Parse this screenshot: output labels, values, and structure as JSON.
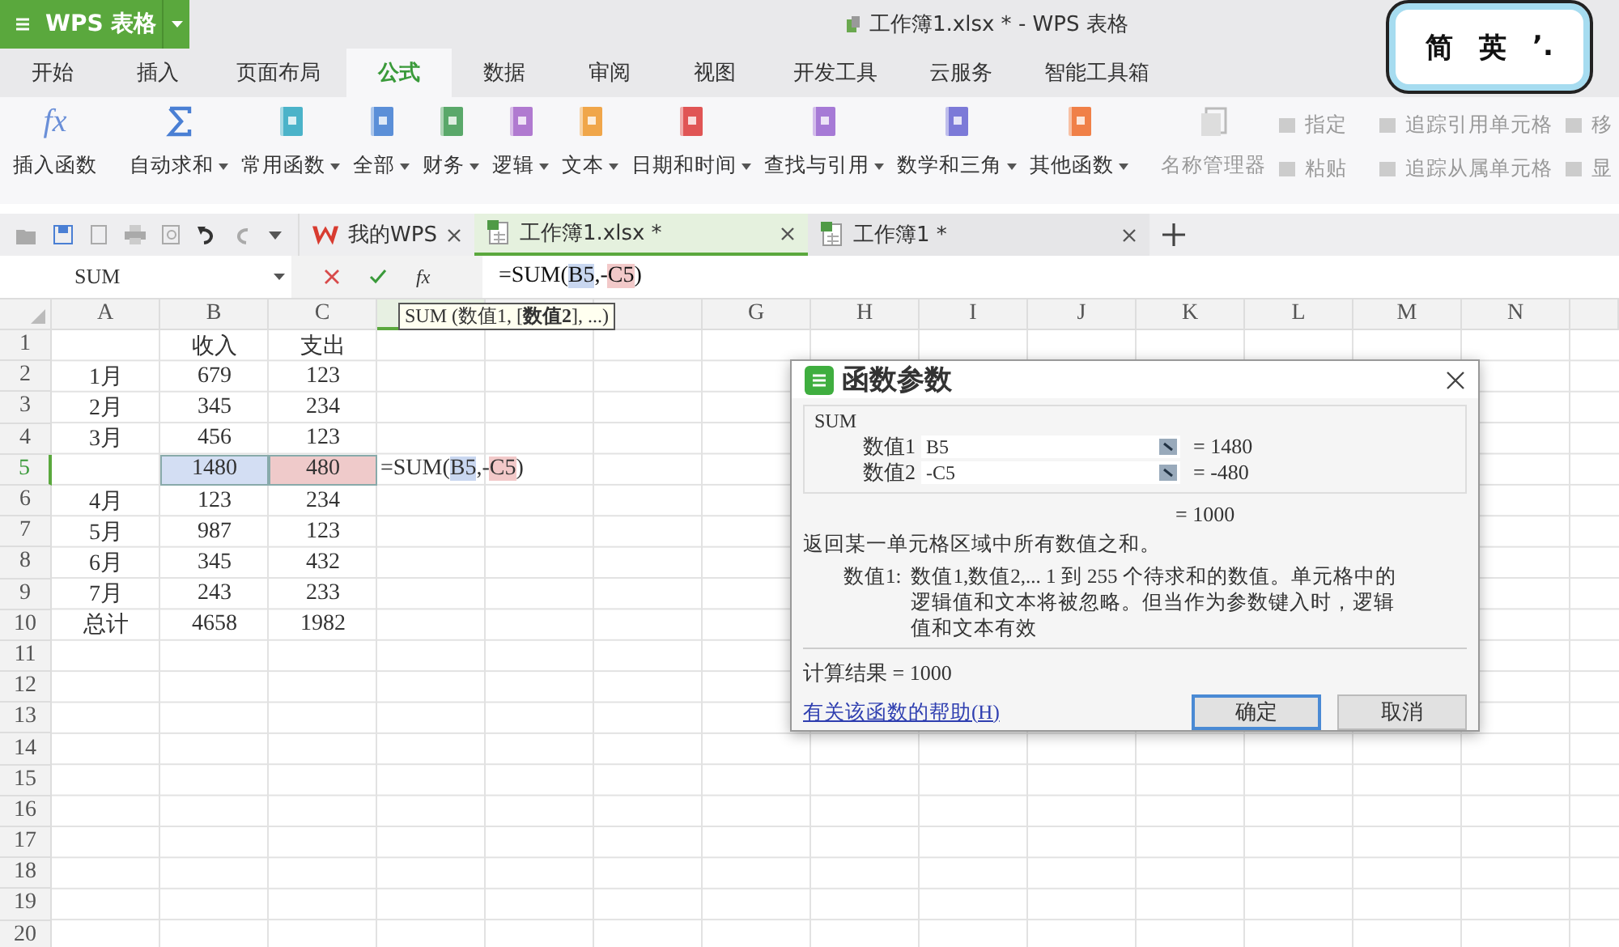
{
  "app_button": {
    "label": "WPS 表格"
  },
  "window": {
    "title": "工作簿1.xlsx * - WPS 表格"
  },
  "ime": {
    "chars": [
      "简",
      "英",
      "’."
    ]
  },
  "menu_tabs": [
    {
      "label": "开始",
      "selected": false
    },
    {
      "label": "插入",
      "selected": false
    },
    {
      "label": "页面布局",
      "selected": false
    },
    {
      "label": "公式",
      "selected": true
    },
    {
      "label": "数据",
      "selected": false
    },
    {
      "label": "审阅",
      "selected": false
    },
    {
      "label": "视图",
      "selected": false
    },
    {
      "label": "开发工具",
      "selected": false
    },
    {
      "label": "云服务",
      "selected": false
    },
    {
      "label": "智能工具箱",
      "selected": false
    }
  ],
  "ribbon": {
    "insert_function": {
      "icon": "fx",
      "label": "插入函数"
    },
    "functions": [
      {
        "label": "自动求和",
        "kind": "sigma",
        "color": "#4a7fd4"
      },
      {
        "label": "常用函数",
        "kind": "book",
        "color": "#4bb3c9"
      },
      {
        "label": "全部",
        "kind": "book",
        "color": "#5b8fd8"
      },
      {
        "label": "财务",
        "kind": "book",
        "color": "#5aa86a"
      },
      {
        "label": "逻辑",
        "kind": "book",
        "color": "#b07ad0"
      },
      {
        "label": "文本",
        "kind": "book",
        "color": "#f0a64a"
      },
      {
        "label": "日期和时间",
        "kind": "book",
        "color": "#e05555"
      },
      {
        "label": "查找与引用",
        "kind": "book",
        "color": "#a67ad6"
      },
      {
        "label": "数学和三角",
        "kind": "book",
        "color": "#7c7ad8"
      },
      {
        "label": "其他函数",
        "kind": "book",
        "color": "#f08048"
      }
    ],
    "name_manager": {
      "label": "名称管理器",
      "disabled": true
    },
    "small_buttons": [
      {
        "label": "指定",
        "disabled": true
      },
      {
        "label": "粘贴",
        "disabled": true
      }
    ],
    "trace_buttons": [
      {
        "label": "追踪引用单元格",
        "disabled": true
      },
      {
        "label": "追踪从属单元格",
        "disabled": true
      }
    ],
    "cut_buttons": [
      {
        "label": "移",
        "disabled": true
      },
      {
        "label": "显",
        "disabled": true
      }
    ]
  },
  "doc_tabs": [
    {
      "label": "我的WPS",
      "kind": "home",
      "selected": false
    },
    {
      "label": "工作簿1.xlsx *",
      "kind": "sheet",
      "selected": true
    },
    {
      "label": "工作簿1 *",
      "kind": "sheet",
      "selected": false
    }
  ],
  "formula_bar": {
    "name_box": "SUM",
    "fx_button": "fx",
    "segments": [
      {
        "text": "=SUM("
      },
      {
        "text": "B5",
        "color": "#c9d7f0"
      },
      {
        "text": ",-"
      },
      {
        "text": "C5",
        "color": "#f2c9c9"
      },
      {
        "text": ")"
      }
    ]
  },
  "sheet": {
    "columns": [
      {
        "label": "A",
        "selected": false
      },
      {
        "label": "B",
        "selected": false
      },
      {
        "label": "C",
        "selected": false
      },
      {
        "selected": true
      },
      {
        "selected": false
      },
      {
        "selected": false
      },
      {
        "label": "G",
        "selected": false
      },
      {
        "label": "H",
        "selected": false
      },
      {
        "label": "I",
        "selected": false
      },
      {
        "label": "J",
        "selected": false
      },
      {
        "label": "K",
        "selected": false
      },
      {
        "label": "L",
        "selected": false
      },
      {
        "label": "M",
        "selected": false
      },
      {
        "label": "N",
        "selected": false
      }
    ],
    "rows": [
      {
        "label": "1",
        "selected": false,
        "cells": [
          null,
          {
            "text": "收入"
          },
          {
            "text": "支出"
          }
        ]
      },
      {
        "label": "2",
        "selected": false,
        "cells": [
          {
            "text": "1月"
          },
          {
            "text": "679"
          },
          {
            "text": "123"
          }
        ]
      },
      {
        "label": "3",
        "selected": false,
        "cells": [
          {
            "text": "2月"
          },
          {
            "text": "345"
          },
          {
            "text": "234"
          }
        ]
      },
      {
        "label": "4",
        "selected": false,
        "cells": [
          {
            "text": "3月"
          },
          {
            "text": "456"
          },
          {
            "text": "123"
          }
        ]
      },
      {
        "label": "5",
        "selected": true,
        "cells": [
          null,
          {
            "text": "1480",
            "color": "#d3def3"
          },
          {
            "text": "480",
            "color": "#efcaca"
          },
          {
            "kind": "formula",
            "segments": [
              {
                "text": "=SUM("
              },
              {
                "text": "B5",
                "color": "#c9d7f0"
              },
              {
                "text": ",-"
              },
              {
                "text": "C5",
                "color": "#f2c9c9"
              },
              {
                "text": ")"
              }
            ]
          }
        ]
      },
      {
        "label": "6",
        "selected": false,
        "cells": [
          {
            "text": "4月"
          },
          {
            "text": "123"
          },
          {
            "text": "234"
          }
        ]
      },
      {
        "label": "7",
        "selected": false,
        "cells": [
          {
            "text": "5月"
          },
          {
            "text": "987"
          },
          {
            "text": "123"
          }
        ]
      },
      {
        "label": "8",
        "selected": false,
        "cells": [
          {
            "text": "6月"
          },
          {
            "text": "345"
          },
          {
            "text": "432"
          }
        ]
      },
      {
        "label": "9",
        "selected": false,
        "cells": [
          {
            "text": "7月"
          },
          {
            "text": "243"
          },
          {
            "text": "233"
          }
        ]
      },
      {
        "label": "10",
        "selected": false,
        "cells": [
          {
            "text": "总计"
          },
          {
            "text": "4658"
          },
          {
            "text": "1982"
          }
        ]
      },
      {
        "label": "11",
        "selected": false,
        "cells": []
      },
      {
        "label": "12",
        "selected": false,
        "cells": []
      },
      {
        "label": "13",
        "selected": false,
        "cells": []
      },
      {
        "label": "14",
        "selected": false,
        "cells": []
      },
      {
        "label": "15",
        "selected": false,
        "cells": []
      },
      {
        "label": "16",
        "selected": false,
        "cells": []
      },
      {
        "label": "17",
        "selected": false,
        "cells": []
      },
      {
        "label": "18",
        "selected": false,
        "cells": []
      },
      {
        "label": "19",
        "selected": false,
        "cells": []
      },
      {
        "label": "20",
        "selected": false,
        "cells": []
      }
    ],
    "tooltip": "SUM (数值1, [**数值2**], ...)"
  },
  "dialog": {
    "title": "函数参数",
    "function_name": "SUM",
    "args": [
      {
        "label": "数值1",
        "value": "B5",
        "result": "= 1480"
      },
      {
        "label": "数值2",
        "value": "-C5",
        "result": "= -480"
      }
    ],
    "total": "= 1000",
    "description": "返回某一单元格区域中所有数值之和。",
    "arg_help": {
      "label": "数值1:",
      "text": "数值1,数值2,... 1 到 255 个待求和的数值。单元格中的逻辑值和文本将被忽略。但当作为参数键入时，逻辑值和文本有效"
    },
    "result": "计算结果 = 1000",
    "help_link": "有关该函数的帮助(H)",
    "buttons": [
      {
        "label": "确定",
        "kind": "primary"
      },
      {
        "label": "取消",
        "kind": "normal"
      }
    ]
  }
}
